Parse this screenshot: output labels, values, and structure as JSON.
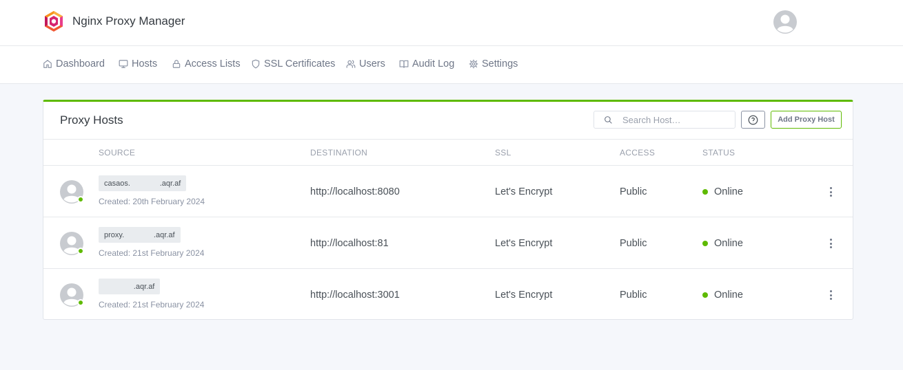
{
  "app": {
    "name": "Nginx Proxy Manager"
  },
  "nav": [
    {
      "label": "Dashboard",
      "icon": "home-icon"
    },
    {
      "label": "Hosts",
      "icon": "monitor-icon"
    },
    {
      "label": "Access Lists",
      "icon": "lock-icon"
    },
    {
      "label": "SSL Certificates",
      "icon": "shield-icon"
    },
    {
      "label": "Users",
      "icon": "users-icon"
    },
    {
      "label": "Audit Log",
      "icon": "book-icon"
    },
    {
      "label": "Settings",
      "icon": "gear-icon"
    }
  ],
  "card": {
    "title": "Proxy Hosts",
    "search_placeholder": "Search Host…",
    "add_button": "Add Proxy Host"
  },
  "columns": {
    "source": "SOURCE",
    "destination": "DESTINATION",
    "ssl": "SSL",
    "access": "ACCESS",
    "status": "STATUS"
  },
  "rows": [
    {
      "domain": "casaos.              .aqr.af",
      "created": "Created: 20th February 2024",
      "destination": "http://localhost:8080",
      "ssl": "Let's Encrypt",
      "access": "Public",
      "status": "Online"
    },
    {
      "domain": "proxy.              .aqr.af",
      "created": "Created: 21st February 2024",
      "destination": "http://localhost:81",
      "ssl": "Let's Encrypt",
      "access": "Public",
      "status": "Online"
    },
    {
      "domain": "              .aqr.af",
      "created": "Created: 21st February 2024",
      "destination": "http://localhost:3001",
      "ssl": "Let's Encrypt",
      "access": "Public",
      "status": "Online"
    }
  ],
  "colors": {
    "accent": "#5eba00",
    "online": "#5eba00"
  }
}
